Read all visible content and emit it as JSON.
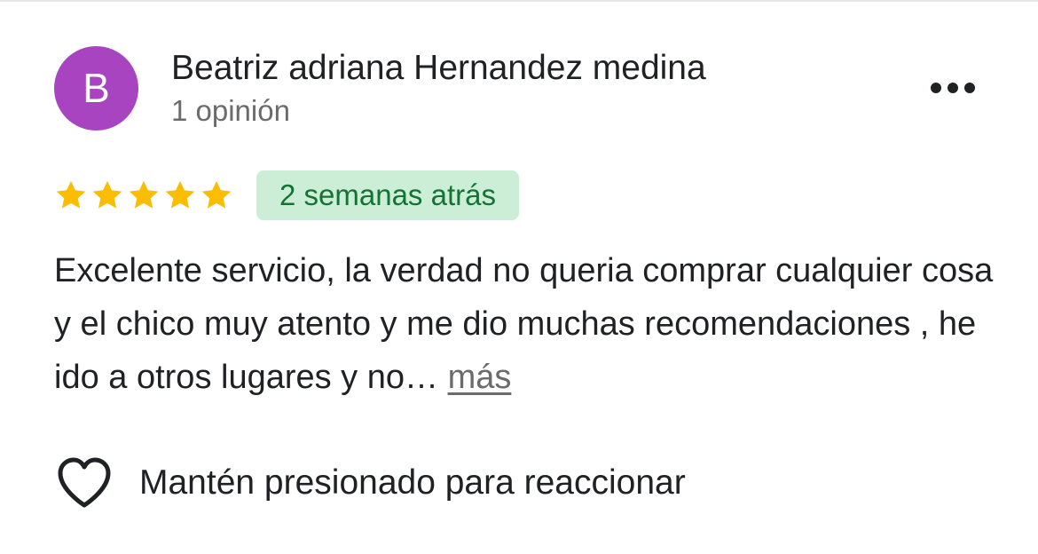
{
  "review": {
    "author": {
      "initial": "B",
      "name": "Beatriz adriana Hernandez medina",
      "reviews_count": "1 opinión",
      "avatar_color": "#a844c0"
    },
    "menu_icon": "more-horizontal-icon",
    "rating": {
      "stars": 5,
      "max": 5,
      "star_color": "#fbbc04"
    },
    "date": "2 semanas atrás",
    "text": "Excelente servicio, la verdad no queria comprar cualquier cosa y el chico muy atento y me dio muchas recomendaciones , he ido a otros lugares y no…",
    "more_label": "más",
    "react": {
      "icon": "heart-icon",
      "label": "Mantén presionado para reaccionar"
    }
  },
  "colors": {
    "badge_bg": "#cdeed6",
    "badge_text": "#137333",
    "primary_text": "#202124",
    "secondary_text": "#6b6b6b"
  }
}
